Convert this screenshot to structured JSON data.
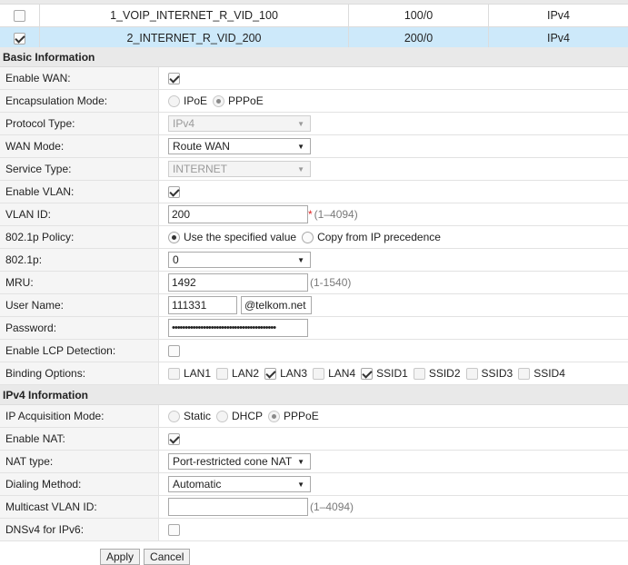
{
  "wan_list": [
    {
      "name": "1_VOIP_INTERNET_R_VID_100",
      "vlan": "100/0",
      "protocol": "IPv4",
      "checked": false
    },
    {
      "name": "2_INTERNET_R_VID_200",
      "vlan": "200/0",
      "protocol": "IPv4",
      "checked": true
    }
  ],
  "basic": {
    "title": "Basic Information",
    "enable_wan_label": "Enable WAN:",
    "encap_label": "Encapsulation Mode:",
    "encap_ipoe": "IPoE",
    "encap_pppoe": "PPPoE",
    "protocol_label": "Protocol Type:",
    "protocol_value": "IPv4",
    "wanmode_label": "WAN Mode:",
    "wanmode_value": "Route WAN",
    "service_label": "Service Type:",
    "service_value": "INTERNET",
    "vlan_enable_label": "Enable VLAN:",
    "vlanid_label": "VLAN ID:",
    "vlanid_value": "200",
    "vlanid_req": "*",
    "vlanid_hint": "(1–4094)",
    "policy_label": "802.1p Policy:",
    "policy_opt1": "Use the specified value",
    "policy_opt2": "Copy from IP precedence",
    "p8021_label": "802.1p:",
    "p8021_value": "0",
    "mru_label": "MRU:",
    "mru_value": "1492",
    "mru_hint": "(1-1540)",
    "user_label": "User Name:",
    "user_value": "111331",
    "user_domain": "@telkom.net",
    "pw_label": "Password:",
    "pw_value": "••••••••••••••••••••••••••••••••••••••••",
    "lcp_label": "Enable LCP Detection:",
    "binding_label": "Binding Options:",
    "bindings": [
      {
        "name": "LAN1",
        "checked": false
      },
      {
        "name": "LAN2",
        "checked": false
      },
      {
        "name": "LAN3",
        "checked": true
      },
      {
        "name": "LAN4",
        "checked": false
      },
      {
        "name": "SSID1",
        "checked": true
      },
      {
        "name": "SSID2",
        "checked": false
      },
      {
        "name": "SSID3",
        "checked": false
      },
      {
        "name": "SSID4",
        "checked": false
      }
    ]
  },
  "ipv4": {
    "title": "IPv4 Information",
    "acq_label": "IP Acquisition Mode:",
    "acq_static": "Static",
    "acq_dhcp": "DHCP",
    "acq_pppoe": "PPPoE",
    "nat_label": "Enable NAT:",
    "nattype_label": "NAT type:",
    "nattype_value": "Port-restricted cone NAT",
    "dial_label": "Dialing Method:",
    "dial_value": "Automatic",
    "mvlan_label": "Multicast VLAN ID:",
    "mvlan_value": "",
    "mvlan_hint": "(1–4094)",
    "dns_label": "DNSv4 for IPv6:"
  },
  "actions": {
    "apply": "Apply",
    "cancel": "Cancel"
  },
  "icons": {
    "dropdown": "dropdown-arrow-icon"
  }
}
